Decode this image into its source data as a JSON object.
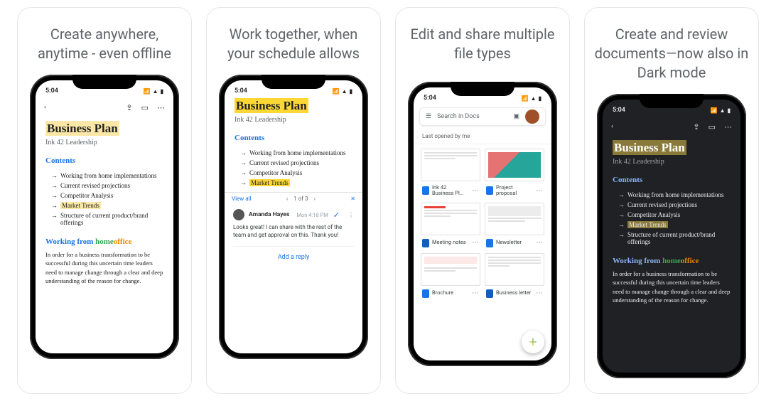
{
  "captions": [
    "Create anywhere, anytime - even offline",
    "Work together, when your schedule allows",
    "Edit and share multiple file types",
    "Create and review documents—now also in Dark mode"
  ],
  "status_time": "5:04",
  "doc": {
    "title": "Business Plan",
    "subtitle": "Ink 42 Leadership",
    "contents_heading": "Contents",
    "toc": [
      "Working from home implementations",
      "Current revised projections",
      "Competitor Analysis",
      "Market Trends",
      "Structure of current product/brand offerings"
    ],
    "working_heading_parts": [
      "Working from ",
      "home",
      "office"
    ],
    "body": "In order for a business transformation to be successful during this uncertain time leaders need to manage change through a clear and deep understanding of the reason for change."
  },
  "comment": {
    "view_all": "View all",
    "pager": "1 of 3",
    "close": "✕",
    "author": "Amanda Hayes",
    "time": "Mon 4:18 PM",
    "text": "Looks great! I can share with the rest of the team and get approval on this. Thank you!",
    "add_reply": "Add a reply"
  },
  "docs_list": {
    "search_placeholder": "Search in Docs",
    "header": "Last opened by me",
    "files": [
      {
        "name": "Ink 42 Business Pl...",
        "type": "doc"
      },
      {
        "name": "Project proposal",
        "type": "doc"
      },
      {
        "name": "Meeting notes",
        "type": "word"
      },
      {
        "name": "Newsletter",
        "type": "doc"
      },
      {
        "name": "Brochure",
        "type": "doc"
      },
      {
        "name": "Business letter",
        "type": "word"
      }
    ]
  }
}
